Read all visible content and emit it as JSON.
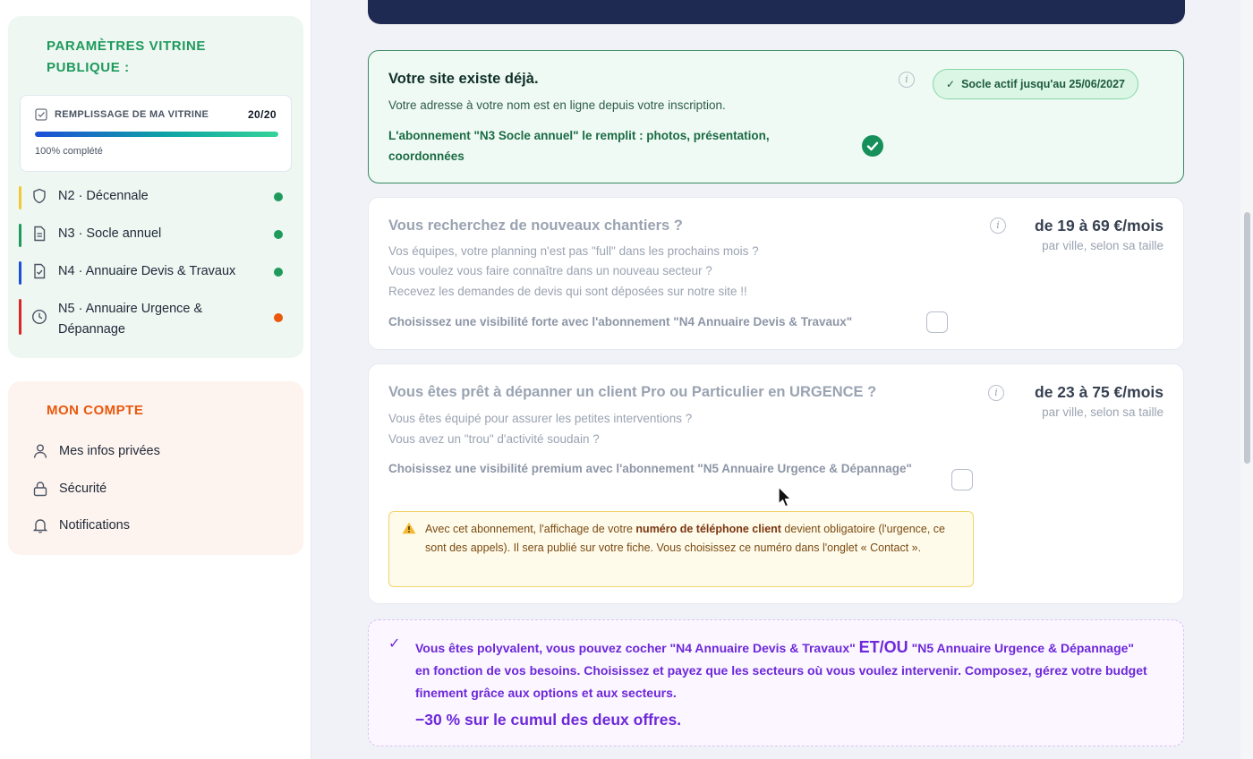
{
  "sidebar": {
    "vitrine": {
      "title": "Paramètres vitrine publique :",
      "fill": {
        "label": "REMPLISSAGE DE MA VITRINE",
        "count": "20/20",
        "progress": 1.0,
        "percent_text": "100% complété"
      },
      "items": [
        {
          "label": "N2 · Décennale",
          "color": "#f2c832",
          "status": "#1e9a5c"
        },
        {
          "label": "N3 · Socle annuel",
          "color": "#1e9a5c",
          "status": "#1e9a5c"
        },
        {
          "label": "N4 · Annuaire Devis & Travaux",
          "color": "#1d4ed8",
          "status": "#1e9a5c"
        },
        {
          "label": "N5 · Annuaire Urgence & Dépannage",
          "color": "#dc2626",
          "status": "#ea580c"
        }
      ]
    },
    "compte": {
      "title": "Mon compte",
      "items": [
        {
          "label": "Mes infos privées"
        },
        {
          "label": "Sécurité"
        },
        {
          "label": "Notifications"
        }
      ]
    }
  },
  "socle": {
    "title": "Votre site existe déjà.",
    "line1": "Votre adresse à votre nom est en ligne depuis votre inscription.",
    "line2": "L'abonnement \"N3 Socle annuel\" le remplit : photos, présentation, coordonnées",
    "badge": "Socle actif jusqu'au 25/06/2027"
  },
  "n4": {
    "title": "Vous recherchez de nouveaux chantiers ?",
    "lines": [
      "Vos équipes, votre planning n'est pas \"full\" dans les prochains mois ?",
      "Vous voulez vous faire connaître dans un nouveau secteur ?",
      "Recevez les demandes de devis qui sont déposées sur notre site !!"
    ],
    "choice": "Choisissez une visibilité forte avec l'abonnement \"N4 Annuaire Devis & Travaux\"",
    "price": "de 19 à 69 €/mois",
    "price_sub": "par ville, selon sa taille"
  },
  "n5": {
    "title": "Vous êtes prêt à dépanner un client Pro ou Particulier en URGENCE ?",
    "lines": [
      "Vous êtes équipé pour assurer les petites interventions ?",
      "Vous avez un \"trou\" d'activité soudain ?"
    ],
    "choice": "Choisissez une visibilité premium avec l'abonnement \"N5 Annuaire Urgence & Dépannage\"",
    "price": "de 23 à 75 €/mois",
    "price_sub": "par ville, selon sa taille",
    "warning": {
      "before": "Avec cet abonnement, l'affichage de votre ",
      "strong": "numéro de téléphone client",
      "after": " devient obligatoire (l'urgence, ce sont des appels). Il sera publié sur votre fiche. Vous choisissez ce numéro dans l'onglet « Contact »."
    }
  },
  "combo": {
    "text_a": "Vous êtes polyvalent, vous pouvez cocher \"N4 Annuaire Devis & Travaux\" ",
    "text_big": "ET/OU",
    "text_b": " \"N5 Annuaire Urgence & Dépannage\" en fonction de vos besoins. Choisissez et payez que les secteurs où vous voulez intervenir. Composez, gérez votre budget finement grâce aux options et aux secteurs.",
    "promo": "−30 % sur le cumul des deux offres."
  },
  "colors": {
    "accent_green": "#1e9a5c",
    "accent_orange": "#ea580c",
    "accent_purple": "#6d28d9",
    "hero_navy": "#1e2a52"
  }
}
